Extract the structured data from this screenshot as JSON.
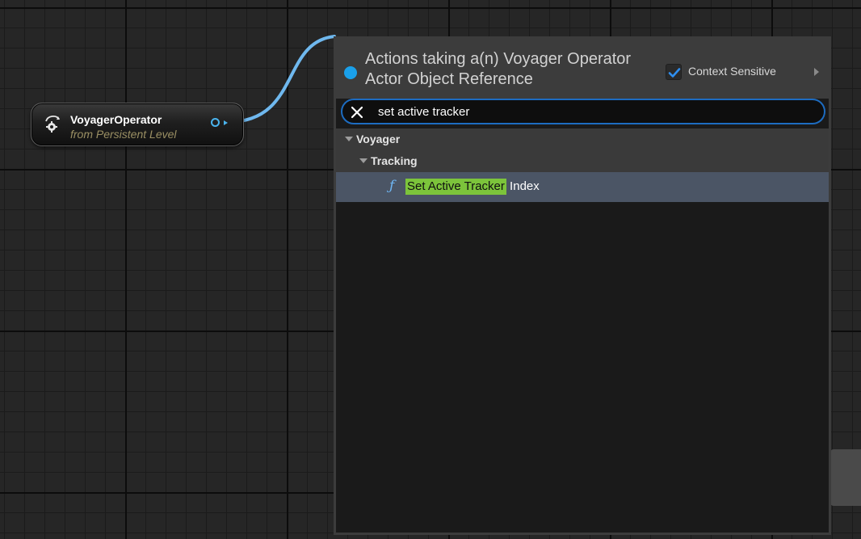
{
  "graph": {
    "actor_node": {
      "title": "VoyagerOperator",
      "subtitle": "from Persistent Level"
    }
  },
  "action_menu": {
    "header_title": "Actions taking a(n) Voyager Operator Actor Object Reference",
    "context_sensitive": {
      "label": "Context Sensitive",
      "checked": true
    },
    "search": {
      "value": "set active tracker"
    },
    "tree": {
      "category": "Voyager",
      "subcategory": "Tracking",
      "action": {
        "match": "Set Active Tracker",
        "rest": " Index"
      }
    }
  },
  "colors": {
    "accent": "#1aa0ea",
    "wire": "#6fb8ee",
    "highlight": "#7cc43b",
    "selected_row": "#4b5565"
  },
  "icons": {
    "search_clear": "close-icon",
    "function": "function-icon",
    "actor": "actor-icon",
    "context_checkbox": "checkmark-icon",
    "context_arrow": "caret-right-icon"
  }
}
